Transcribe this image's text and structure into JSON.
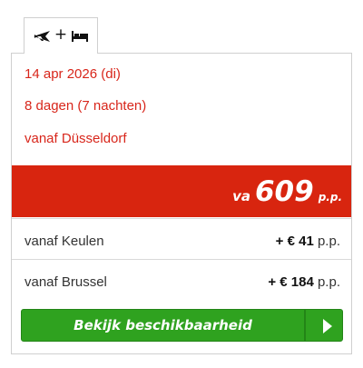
{
  "tab": {
    "icons": [
      "plane-icon",
      "bed-icon"
    ],
    "plus": "+"
  },
  "info": {
    "date": "14 apr 2026 (di)",
    "duration": "8 dagen (7 nachten)",
    "departure": "vanaf Düsseldorf"
  },
  "price": {
    "prefix": "va",
    "amount": "609",
    "suffix": "p.p."
  },
  "alternatives": [
    {
      "label": "vanaf Keulen",
      "amount": "+ € 41",
      "unit": "p.p."
    },
    {
      "label": "vanaf Brussel",
      "amount": "+ € 184",
      "unit": "p.p."
    }
  ],
  "cta": {
    "label": "Bekijk beschikbaarheid"
  },
  "colors": {
    "accent_red": "#d8250f",
    "cta_green": "#2fa21f"
  }
}
